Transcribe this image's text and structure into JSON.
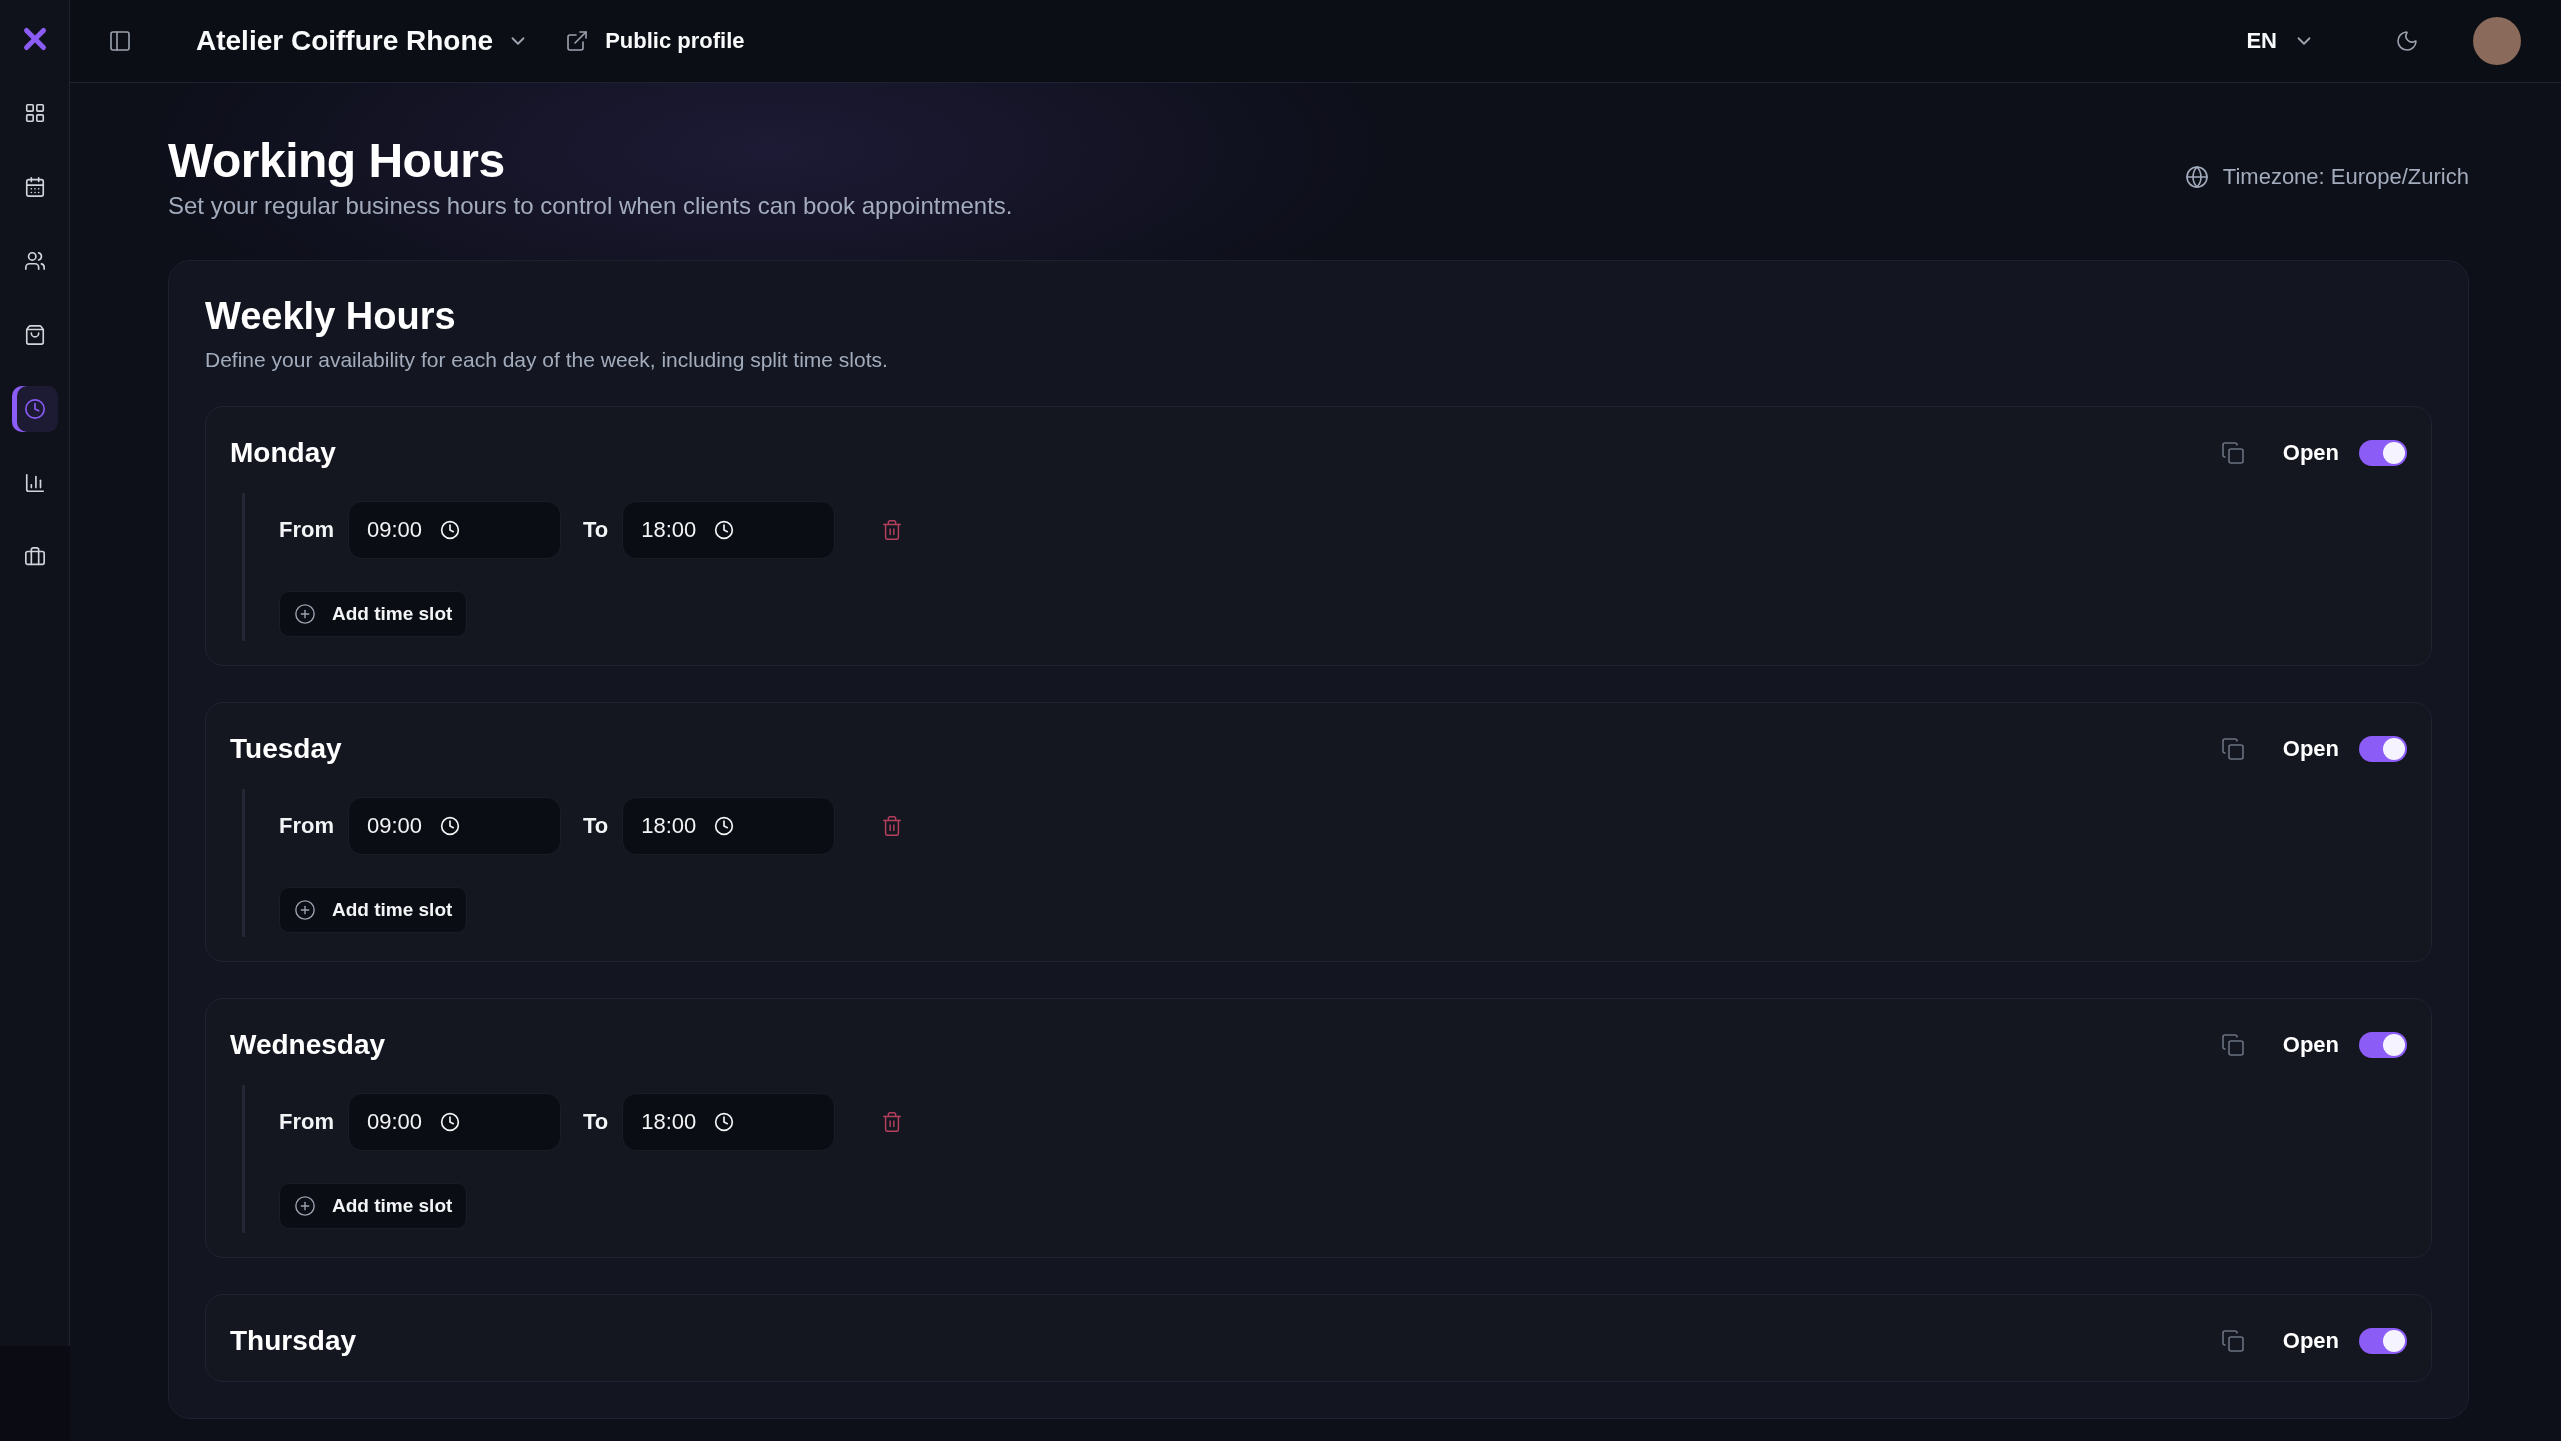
{
  "sidebar": {
    "items": [
      {
        "kind": "dashboard",
        "selected": false
      },
      {
        "kind": "calendar",
        "selected": false
      },
      {
        "kind": "clients",
        "selected": false
      },
      {
        "kind": "shop",
        "selected": false
      },
      {
        "kind": "hours",
        "selected": true
      },
      {
        "kind": "stats",
        "selected": false
      },
      {
        "kind": "business",
        "selected": false
      }
    ]
  },
  "header": {
    "business_name": "Atelier Coiffure Rhone",
    "public_profile": "Public profile",
    "language": "EN"
  },
  "page": {
    "title": "Working Hours",
    "subtitle": "Set your regular business hours to control when clients can book appointments.",
    "timezone": "Timezone: Europe/Zurich"
  },
  "weekly": {
    "title": "Weekly Hours",
    "description": "Define your availability for each day of the week, including split time slots.",
    "days": [
      {
        "name": "Monday",
        "status": "Open",
        "on": true,
        "slots": [
          {
            "from_label": "From",
            "from": "09:00",
            "to_label": "To",
            "to": "18:00"
          }
        ],
        "add_label": "Add time slot"
      },
      {
        "name": "Tuesday",
        "status": "Open",
        "on": true,
        "slots": [
          {
            "from_label": "From",
            "from": "09:00",
            "to_label": "To",
            "to": "18:00"
          }
        ],
        "add_label": "Add time slot"
      },
      {
        "name": "Wednesday",
        "status": "Open",
        "on": true,
        "slots": [
          {
            "from_label": "From",
            "from": "09:00",
            "to_label": "To",
            "to": "18:00"
          }
        ],
        "add_label": "Add time slot"
      },
      {
        "name": "Thursday",
        "status": "Open",
        "on": true
      }
    ]
  }
}
